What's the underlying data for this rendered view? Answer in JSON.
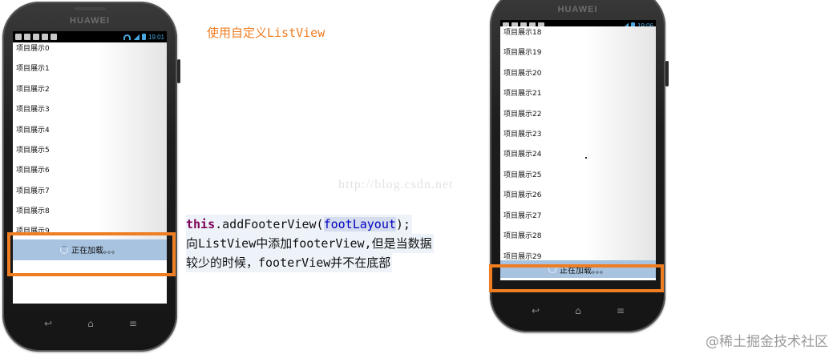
{
  "annotation_title": "使用自定义ListView",
  "watermark": "http://blog.csdn.net",
  "code": {
    "keyword": "this",
    "method_prefix": ".addFooterView(",
    "argument": "footLayout",
    "method_suffix": ");",
    "note_line1": "向ListView中添加footerView,但是当数据",
    "note_line2": "较少的时候，footerView并不在底部"
  },
  "site_mark": "@稀土掘金技术社区",
  "left_phone": {
    "brand": "HUAWEI",
    "time": "19:01",
    "items": [
      "项目展示0",
      "项目展示1",
      "项目展示2",
      "项目展示3",
      "项目展示4",
      "项目展示5",
      "项目展示6",
      "项目展示7",
      "项目展示8",
      "项目展示9"
    ],
    "footer_text": "正在加载。。。"
  },
  "right_phone": {
    "brand": "HUAWEI",
    "time": "19:06",
    "items": [
      "项目展示18",
      "项目展示19",
      "项目展示20",
      "项目展示21",
      "项目展示22",
      "项目展示23",
      "项目展示24",
      "项目展示25",
      "项目展示26",
      "项目展示27",
      "项目展示28",
      "项目展示29"
    ],
    "footer_text": "正在加载。。。"
  },
  "colors": {
    "accent_orange": "#ef7d22",
    "footer_blue": "#a7c3df",
    "keyword_purple": "#7f0055",
    "statusbar_blue": "#4aa8e0"
  },
  "icons": [
    "back-icon",
    "home-icon",
    "menu-icon",
    "wifi-icon",
    "signal-icon",
    "battery-icon",
    "loading-spinner-icon"
  ]
}
